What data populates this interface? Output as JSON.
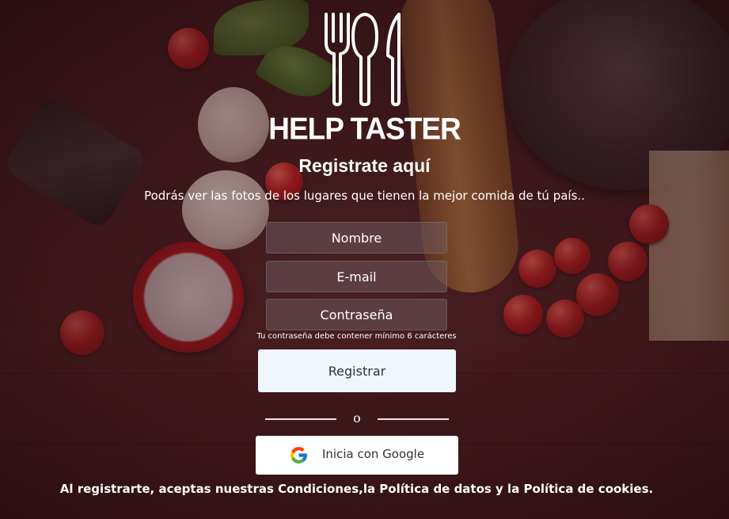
{
  "brand": {
    "name": "HELP TASTER",
    "logo_icon": "fork-spoon-knife-icon"
  },
  "header": {
    "title": "Registrate aquí",
    "subtitle": "Podrás ver las fotos de los lugares que tienen la mejor comida de tú país.."
  },
  "form": {
    "name_placeholder": "Nombre",
    "email_placeholder": "E-mail",
    "password_placeholder": "Contraseña",
    "password_hint": "Tu contraseña debe contener mínimo 6 carácteres",
    "submit_label": "Registrar"
  },
  "divider": {
    "text": "o"
  },
  "google": {
    "label": "Inicia con Google",
    "icon": "google-icon"
  },
  "footer": {
    "terms": "Al registrarte, aceptas nuestras Condiciones,la Política de datos y la Política de cookies."
  },
  "colors": {
    "button_bg": "#f0f7ff",
    "field_bg": "rgba(110,90,95,0.55)",
    "text": "#ffffff"
  }
}
